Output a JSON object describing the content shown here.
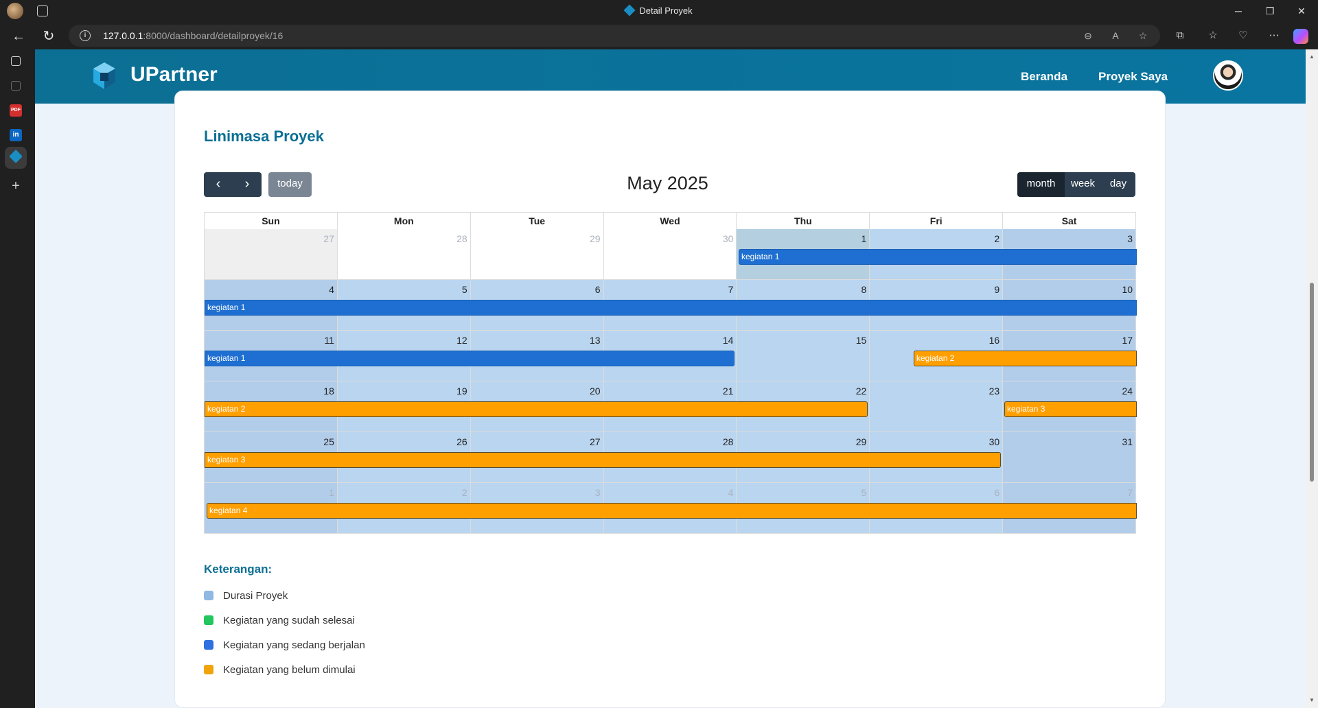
{
  "browser": {
    "tab_title": "Detail Proyek",
    "url_host": "127.0.0.1",
    "url_path": ":8000/dashboard/detailproyek/16"
  },
  "navbar": {
    "brand": "UPartner",
    "links": [
      "Beranda",
      "Proyek Saya"
    ],
    "active_link": "Beranda"
  },
  "page": {
    "section_title": "Linimasa Proyek"
  },
  "calendar": {
    "title": "May 2025",
    "today_label": "today",
    "views": [
      "month",
      "week",
      "day"
    ],
    "active_view": "month",
    "weekdays": [
      "Sun",
      "Mon",
      "Tue",
      "Wed",
      "Thu",
      "Fri",
      "Sat"
    ],
    "weeks": [
      [
        "27",
        "28",
        "29",
        "30",
        "1",
        "2",
        "3"
      ],
      [
        "4",
        "5",
        "6",
        "7",
        "8",
        "9",
        "10"
      ],
      [
        "11",
        "12",
        "13",
        "14",
        "15",
        "16",
        "17"
      ],
      [
        "18",
        "19",
        "20",
        "21",
        "22",
        "23",
        "24"
      ],
      [
        "25",
        "26",
        "27",
        "28",
        "29",
        "30",
        "31"
      ],
      [
        "1",
        "2",
        "3",
        "4",
        "5",
        "6",
        "7"
      ]
    ],
    "events": [
      {
        "title": "kegiatan 1",
        "color": "#1e6fd1",
        "status": "Kegiatan yang sedang berjalan"
      },
      {
        "title": "kegiatan 2",
        "color": "#ff9f00",
        "status": "Kegiatan yang belum dimulai"
      },
      {
        "title": "kegiatan 3",
        "color": "#ff9f00",
        "status": "Kegiatan yang belum dimulai"
      },
      {
        "title": "kegiatan 4",
        "color": "#ff9f00",
        "status": "Kegiatan yang belum dimulai"
      }
    ]
  },
  "legend": {
    "title": "Keterangan:",
    "items": [
      {
        "label": "Durasi Proyek",
        "color": "#8fb8e3"
      },
      {
        "label": "Kegiatan yang sudah selesai",
        "color": "#22c55e"
      },
      {
        "label": "Kegiatan yang sedang berjalan",
        "color": "#2f6fe0"
      },
      {
        "label": "Kegiatan yang belum dimulai",
        "color": "#f0a30a"
      }
    ]
  }
}
